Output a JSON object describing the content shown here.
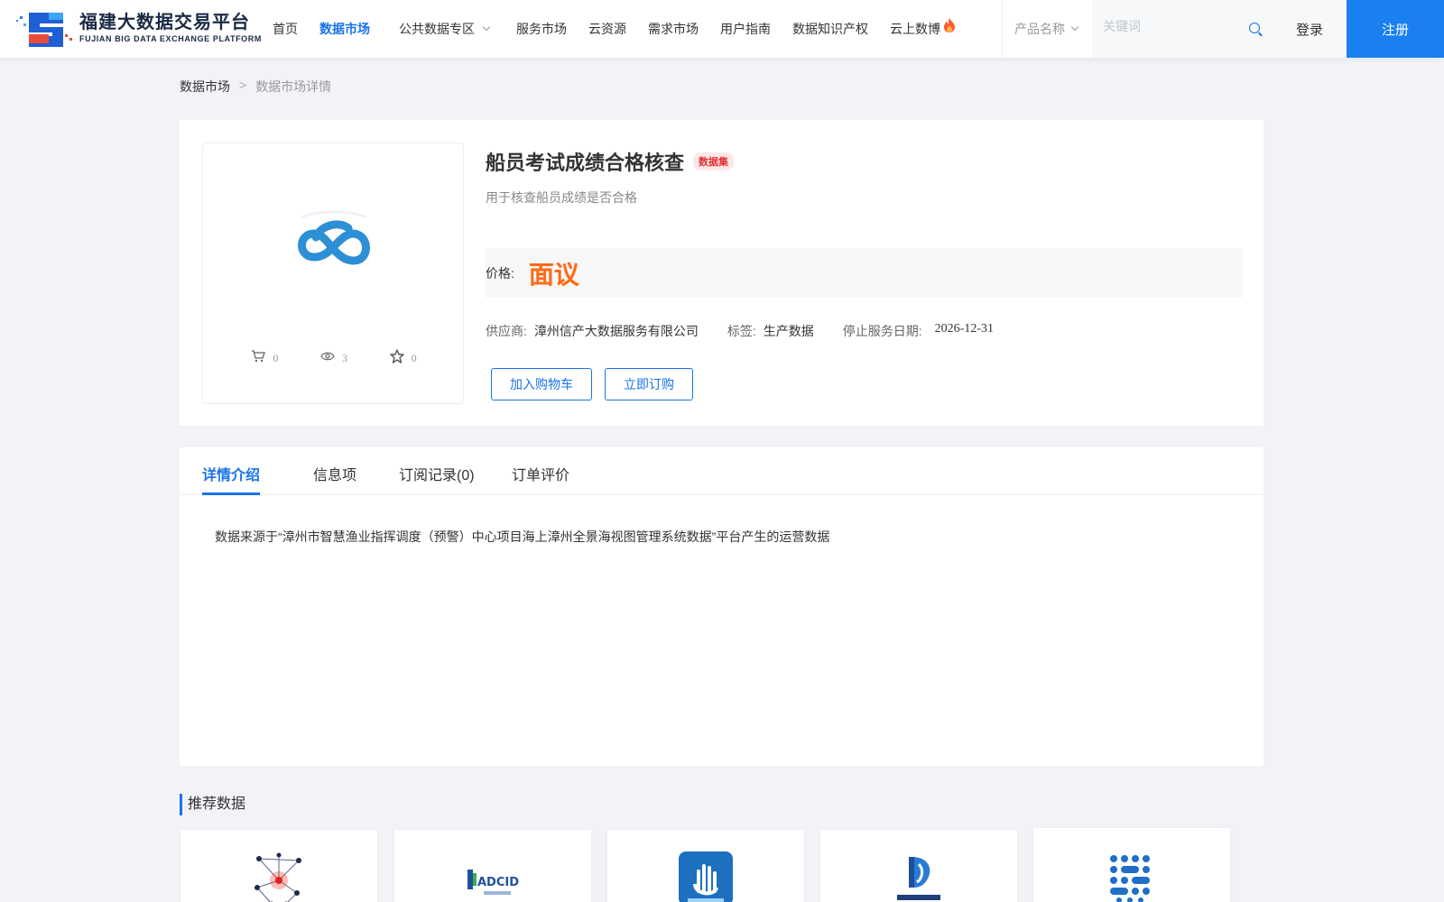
{
  "header": {
    "logo_cn": "福建大数据交易平台",
    "logo_en": "FUJIAN BIG DATA EXCHANGE PLATFORM",
    "nav": [
      {
        "label": "首页",
        "active": false
      },
      {
        "label": "数据市场",
        "active": true
      },
      {
        "label": "公共数据专区",
        "active": false,
        "dropdown": true
      },
      {
        "label": "服务市场",
        "active": false
      },
      {
        "label": "云资源",
        "active": false
      },
      {
        "label": "需求市场",
        "active": false
      },
      {
        "label": "用户指南",
        "active": false
      },
      {
        "label": "数据知识产权",
        "active": false
      },
      {
        "label": "云上数博",
        "active": false,
        "hot": true
      }
    ],
    "search_type": "产品名称",
    "search_placeholder": "关键词",
    "login": "登录",
    "register": "注册"
  },
  "breadcrumb": {
    "root": "数据市场",
    "sep": ">",
    "current": "数据市场详情"
  },
  "product": {
    "title": "船员考试成绩合格核查",
    "badge": "数据集",
    "desc": "用于核查船员成绩是否合格",
    "price_label": "价格:",
    "price_value": "面议",
    "supplier_label": "供应商:",
    "supplier": "漳州信产大数据服务有限公司",
    "tag_label": "标签:",
    "tag": "生产数据",
    "stop_label": "停止服务日期:",
    "stop_date": "2026-12-31",
    "add_cart": "加入购物车",
    "subscribe": "立即订购",
    "stats": {
      "cart": "0",
      "views": "3",
      "favorites": "0"
    }
  },
  "tabs": [
    {
      "label": "详情介绍",
      "active": true
    },
    {
      "label": "信息项",
      "active": false
    },
    {
      "label": "订阅记录(0)",
      "active": false
    },
    {
      "label": "订单评价",
      "active": false
    }
  ],
  "detail_text": "数据来源于“漳州市智慧渔业指挥调度（预警）中心项目海上漳州全景海视图管理系统数据”平台产生的运营数据",
  "recommend": {
    "title": "推荐数据",
    "items": [
      {
        "icon": "network-graph-icon"
      },
      {
        "icon": "adcid-logo-icon"
      },
      {
        "icon": "hand-app-icon"
      },
      {
        "icon": "d-logo-icon"
      },
      {
        "icon": "dot-grid-icon"
      }
    ]
  },
  "colors": {
    "accent": "#1a73e8",
    "price": "#ff6a13",
    "badge_text": "#e03131",
    "register_bg": "#1a7ff0"
  }
}
